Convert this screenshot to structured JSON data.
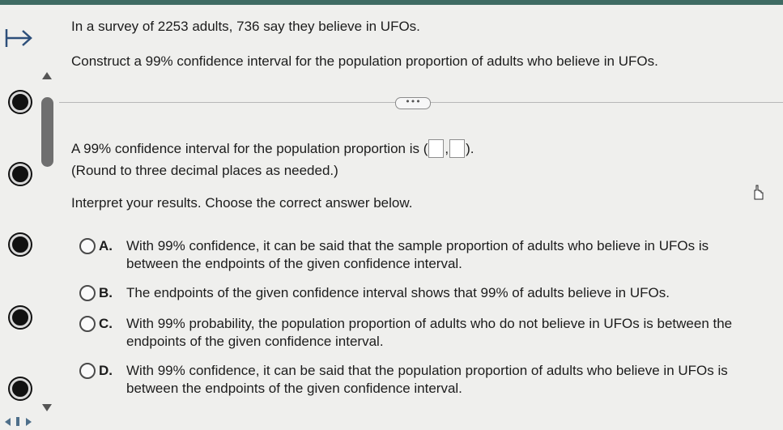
{
  "question": {
    "line1": "In a survey of 2253 adults, 736 say they believe in UFOs.",
    "line2": "Construct a 99% confidence interval for the population proportion of adults who believe in UFOs."
  },
  "more_button": "•••",
  "answer": {
    "prompt": "A 99% confidence interval for the population proportion is (",
    "separator": ",",
    "close": ").",
    "lower_value": "",
    "upper_value": "",
    "note": "(Round to three decimal places as needed.)"
  },
  "interpret_prompt": "Interpret your results. Choose the correct answer below.",
  "options": [
    {
      "letter": "A.",
      "lines": [
        "With 99% confidence, it can be said that the sample proportion of adults who believe in UFOs is",
        "between the endpoints of the given confidence interval."
      ]
    },
    {
      "letter": "B.",
      "lines": [
        "The endpoints of the given confidence interval shows that 99% of adults believe in UFOs."
      ]
    },
    {
      "letter": "C.",
      "lines": [
        "With 99% probability, the population proportion of adults who do not believe in UFOs is between the",
        "endpoints of the given confidence interval."
      ]
    },
    {
      "letter": "D.",
      "lines": [
        "With 99% confidence, it can be said that the population proportion of adults who believe in UFOs is",
        "between the endpoints of the given confidence interval."
      ]
    }
  ],
  "colors": {
    "header_bar": "#3f6b63",
    "background": "#efefed",
    "text": "#1c1c1c"
  }
}
